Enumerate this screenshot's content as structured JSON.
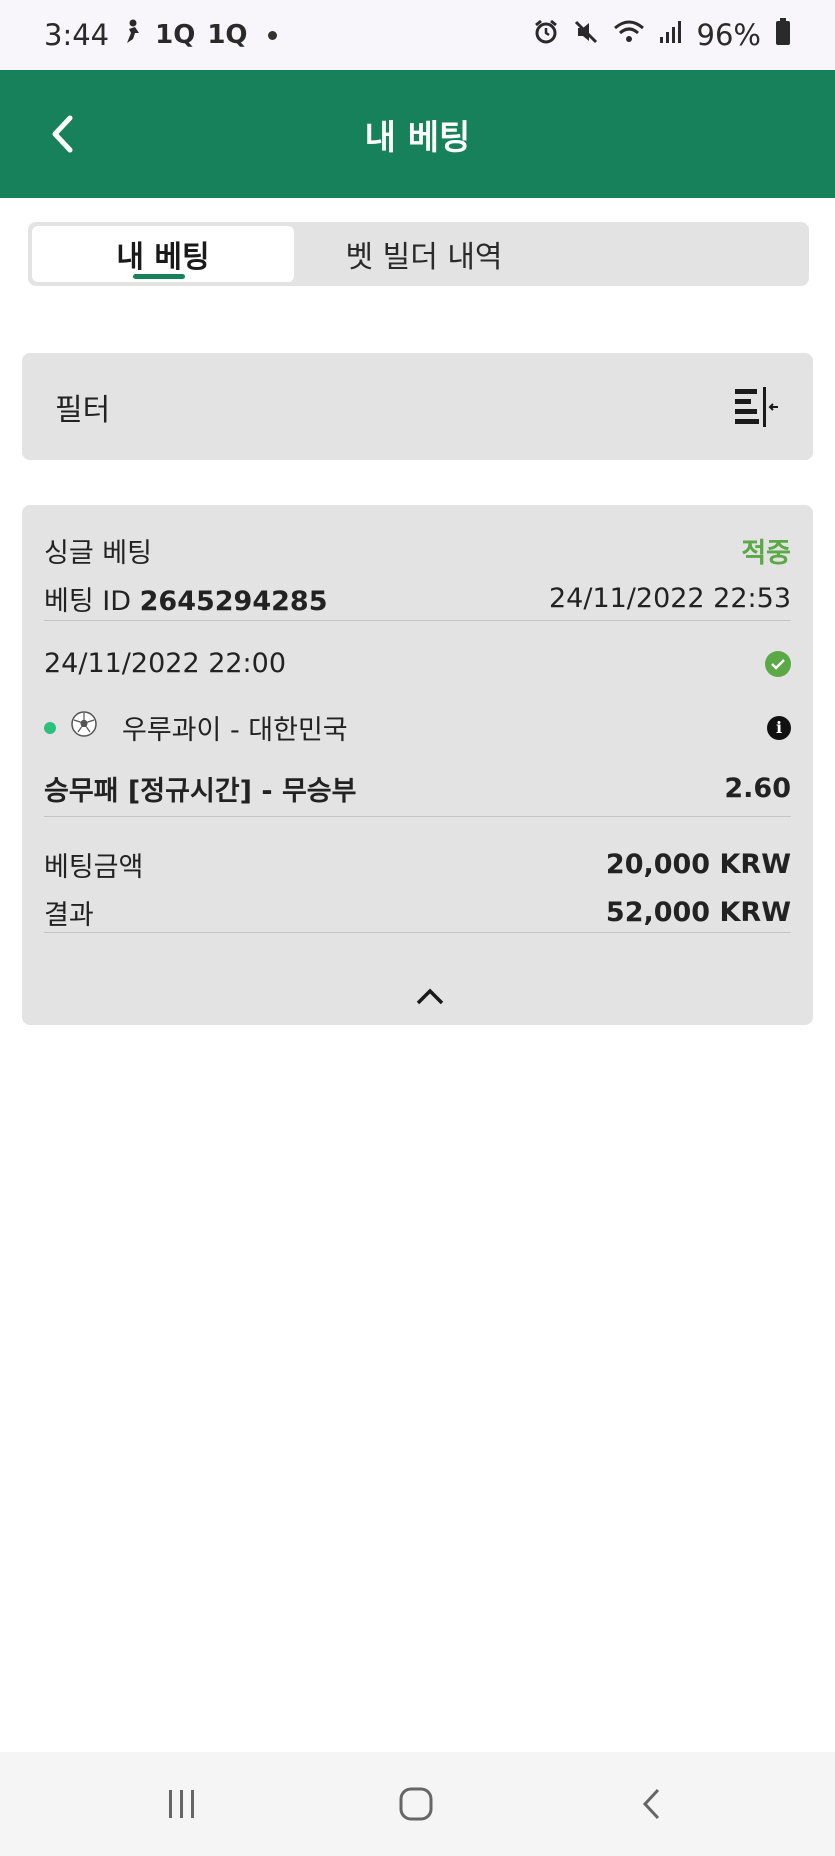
{
  "status_bar": {
    "time": "3:44",
    "left_icons": [
      "person-walk-icon",
      "1q-icon",
      "1q-icon"
    ],
    "right_icons": [
      "alarm-icon",
      "mute-icon",
      "wifi-icon",
      "signal-icon",
      "battery-icon"
    ],
    "battery": "96%",
    "notif_glyph": "1Q"
  },
  "header": {
    "title": "내 베팅"
  },
  "tabs": [
    {
      "label": "내 베팅",
      "active": true
    },
    {
      "label": "벳 빌더 내역",
      "active": false
    }
  ],
  "filter": {
    "label": "필터"
  },
  "bet": {
    "type": "싱글 베팅",
    "status": "적중",
    "id_label": "베팅 ID",
    "id_value": "2645294285",
    "placed_at": "24/11/2022 22:53",
    "event_time": "24/11/2022 22:00",
    "match": "우루과이 - 대한민국",
    "market": "승무패 [정규시간] - 무승부",
    "odds": "2.60",
    "stake_label": "베팅금액",
    "stake_value": "20,000 KRW",
    "result_label": "결과",
    "result_value": "52,000 KRW"
  },
  "colors": {
    "brand": "#17815c",
    "won": "#5aa846",
    "live": "#2cc07d"
  }
}
